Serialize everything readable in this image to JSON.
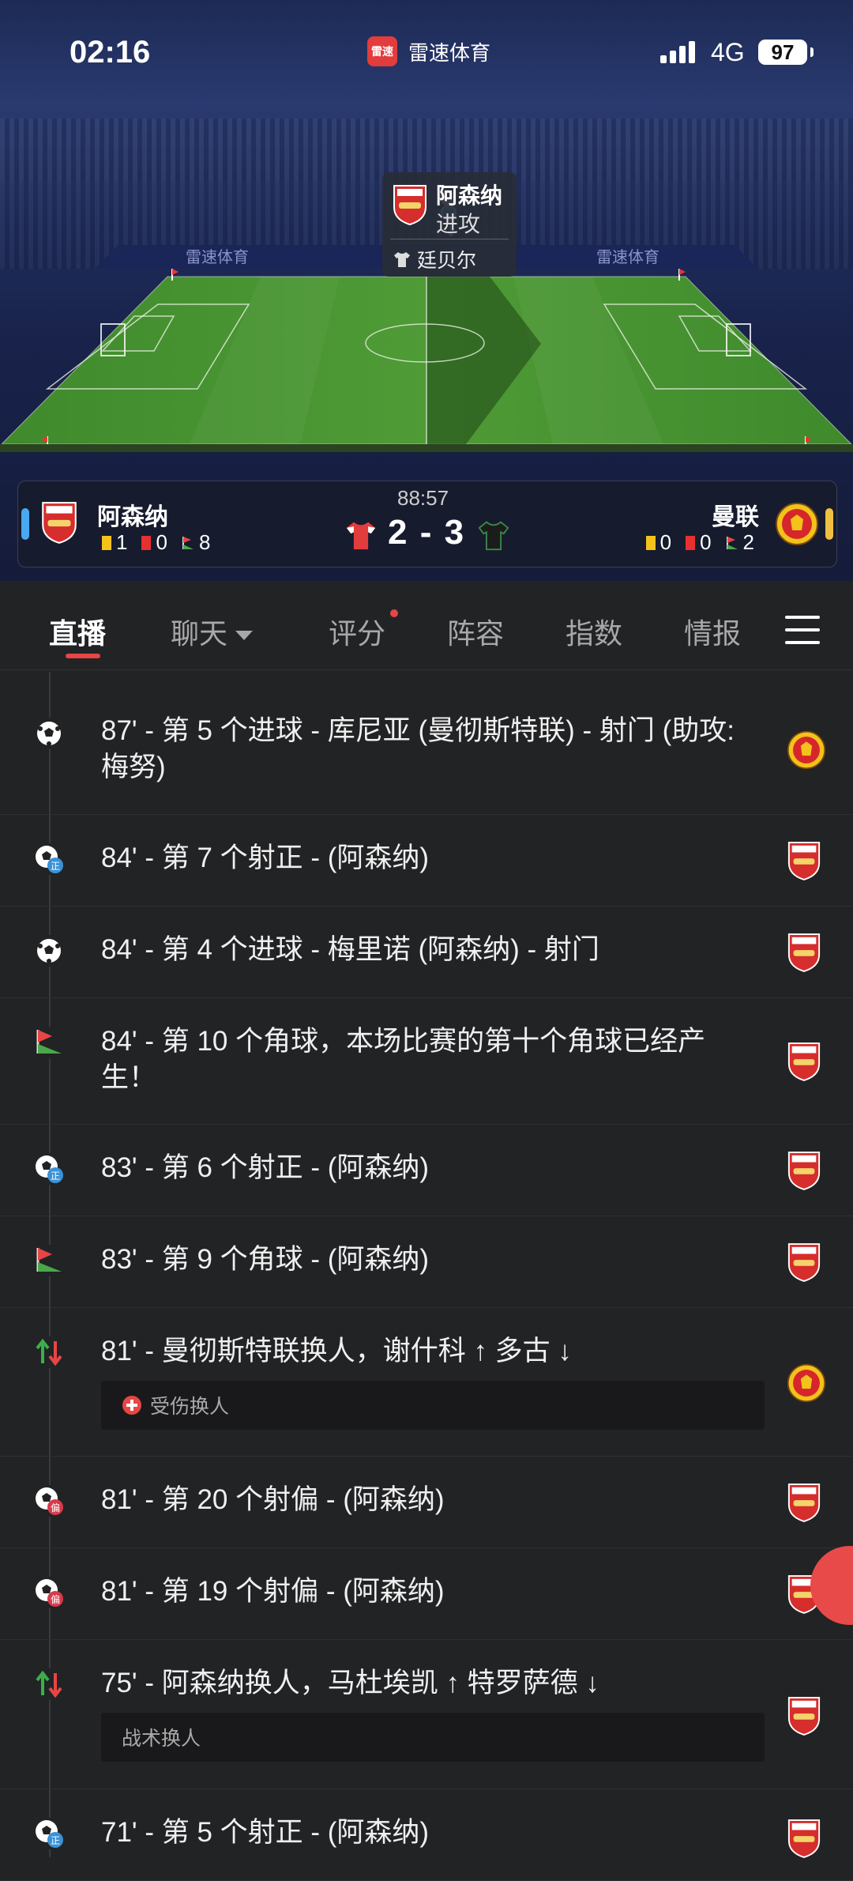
{
  "status_bar": {
    "time": "02:16",
    "app_name": "雷速体育",
    "app_logo_text": "雷速",
    "network": "4G",
    "battery": "97"
  },
  "pitch": {
    "brand_watermark": "雷速体育",
    "attack_card": {
      "team": "阿森纳",
      "state": "进攻",
      "player": "廷贝尔"
    }
  },
  "scoreboard": {
    "match_clock": "88:57",
    "score": "2 - 3",
    "home": {
      "name": "阿森纳",
      "yellow": "1",
      "red": "0",
      "corners": "8",
      "side_color": "#4aa8f0",
      "shirt_color": "#e23c3c"
    },
    "away": {
      "name": "曼联",
      "yellow": "0",
      "red": "0",
      "corners": "2",
      "side_color": "#f0c040",
      "shirt_color": "#1a1a1a"
    }
  },
  "tabs": [
    {
      "label": "直播",
      "active": true
    },
    {
      "label": "聊天",
      "active": false
    },
    {
      "label": "评分",
      "active": false
    },
    {
      "label": "阵容",
      "active": false
    },
    {
      "label": "指数",
      "active": false
    },
    {
      "label": "情报",
      "active": false
    }
  ],
  "events": [
    {
      "icon": "goal-icon",
      "text": "87' - 第 5 个进球 - 库尼亚 (曼彻斯特联) - 射门 (助攻: 梅努)",
      "team": "manutd"
    },
    {
      "icon": "shot-on-target-icon",
      "text": "84' - 第 7 个射正 - (阿森纳)",
      "team": "arsenal"
    },
    {
      "icon": "goal-icon",
      "text": "84' - 第 4 个进球 - 梅里诺 (阿森纳) - 射门",
      "team": "arsenal"
    },
    {
      "icon": "corner-flag-icon",
      "text": "84' - 第 10 个角球，本场比赛的第十个角球已经产生！",
      "team": "arsenal"
    },
    {
      "icon": "shot-on-target-icon",
      "text": "83' - 第 6 个射正 - (阿森纳)",
      "team": "arsenal"
    },
    {
      "icon": "corner-flag-icon",
      "text": "83' - 第 9 个角球 - (阿森纳)",
      "team": "arsenal"
    },
    {
      "icon": "substitution-icon",
      "text": "81' - 曼彻斯特联换人，谢什科 ↑ 多古 ↓",
      "team": "manutd",
      "note": "受伤换人",
      "note_icon": true
    },
    {
      "icon": "shot-off-target-icon",
      "text": "81' - 第 20 个射偏 - (阿森纳)",
      "team": "arsenal"
    },
    {
      "icon": "shot-off-target-icon",
      "text": "81' - 第 19 个射偏 - (阿森纳)",
      "team": "arsenal"
    },
    {
      "icon": "substitution-icon",
      "text": "75' - 阿森纳换人，马杜埃凯 ↑ 特罗萨德 ↓",
      "team": "arsenal",
      "note": "战术换人",
      "note_icon": false
    },
    {
      "icon": "shot-on-target-icon",
      "text": "71' - 第 5 个射正 - (阿森纳)",
      "team": "arsenal"
    }
  ]
}
